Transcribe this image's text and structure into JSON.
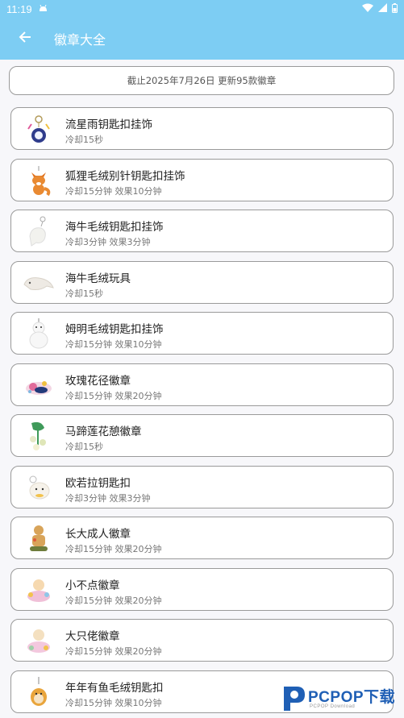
{
  "status_bar": {
    "time": "11:19",
    "notification_icon": "android-icon",
    "wifi_icon": "wifi-icon",
    "signal_icon": "signal-icon",
    "battery_icon": "battery-icon"
  },
  "app_bar": {
    "title": "徽章大全",
    "back_icon": "arrow-left-icon"
  },
  "notice": {
    "text": "截止2025年7月26日 更新95款徽章"
  },
  "items": [
    {
      "name": "流星雨钥匙扣挂饰",
      "meta": "冷却15秒",
      "thumb": "keychain-icon"
    },
    {
      "name": "狐狸毛绒别针钥匙扣挂饰",
      "meta": "冷却15分钟 效果10分钟",
      "thumb": "fox-plush-icon"
    },
    {
      "name": "海牛毛绒钥匙扣挂饰",
      "meta": "冷却3分钟 效果3分钟",
      "thumb": "manatee-keychain-icon"
    },
    {
      "name": "海牛毛绒玩具",
      "meta": "冷却15秒",
      "thumb": "manatee-plush-icon"
    },
    {
      "name": "姆明毛绒钥匙扣挂饰",
      "meta": "冷却15分钟 效果10分钟",
      "thumb": "moomin-plush-icon"
    },
    {
      "name": "玫瑰花径徽章",
      "meta": "冷却15分钟 效果20分钟",
      "thumb": "rose-badge-icon"
    },
    {
      "name": "马蹄莲花憩徽章",
      "meta": "冷却15秒",
      "thumb": "calla-lily-badge-icon"
    },
    {
      "name": "欧若拉钥匙扣",
      "meta": "冷却3分钟 效果3分钟",
      "thumb": "aurora-keychain-icon"
    },
    {
      "name": "长大成人徽章",
      "meta": "冷却15分钟 效果20分钟",
      "thumb": "grown-up-badge-icon"
    },
    {
      "name": "小不点徽章",
      "meta": "冷却15分钟 效果20分钟",
      "thumb": "little-one-badge-icon"
    },
    {
      "name": "大只佬徽章",
      "meta": "冷却15分钟 效果20分钟",
      "thumb": "big-guy-badge-icon"
    },
    {
      "name": "年年有鱼毛绒钥匙扣",
      "meta": "冷却15分钟 效果10分钟",
      "thumb": "fish-plush-icon"
    }
  ],
  "watermark": {
    "brand": "PCPOP下载",
    "sub": "PCPOP Download",
    "logo_icon": "pcpop-logo-icon",
    "brand_color": "#1f5fb5"
  },
  "colors": {
    "accent": "#7dcdf3",
    "background": "#f7f7fa",
    "card_border": "#9a9a9a"
  }
}
